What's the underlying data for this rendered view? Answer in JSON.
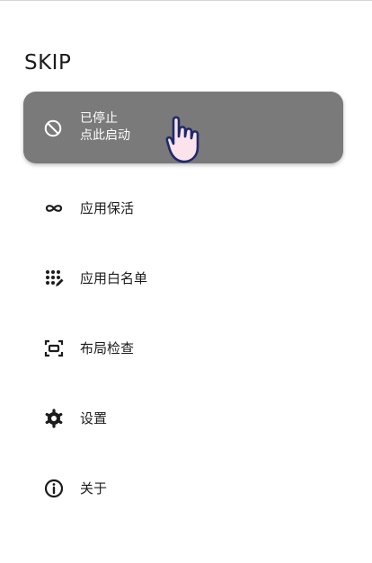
{
  "app": {
    "title": "SKIP"
  },
  "status_card": {
    "line1": "已停止",
    "line2": "点此启动",
    "icon": "block-icon"
  },
  "menu": [
    {
      "label": "应用保活",
      "icon": "infinity-icon"
    },
    {
      "label": "应用白名单",
      "icon": "apps-edit-icon"
    },
    {
      "label": "布局检查",
      "icon": "scan-frame-icon"
    },
    {
      "label": "设置",
      "icon": "gear-icon"
    },
    {
      "label": "关于",
      "icon": "info-icon"
    }
  ],
  "colors": {
    "card_bg": "#7a7a7a",
    "hand_fill": "#fbe3ec",
    "hand_outline": "#1f2a6b"
  }
}
